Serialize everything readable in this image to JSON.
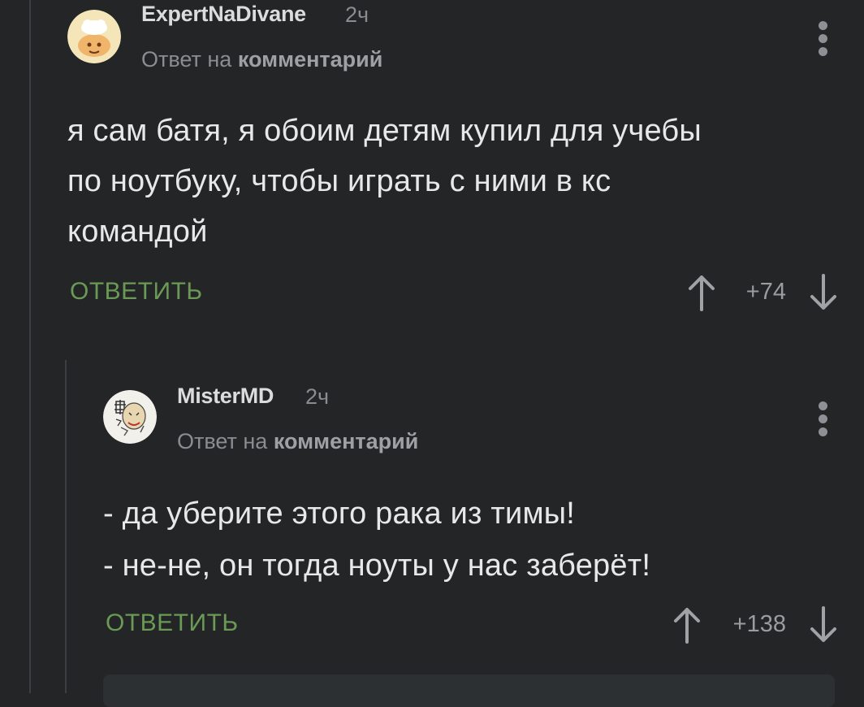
{
  "comments": [
    {
      "username": "ExpertNaDivane",
      "time": "2ч",
      "reply_prefix": "Ответ на",
      "reply_target": "комментарий",
      "body": [
        "я сам батя, я обоим детям купил для учебы",
        "по ноутбуку, чтобы играть с ними в кс",
        "командой"
      ],
      "reply_label": "ОТВЕТИТЬ",
      "score": "+74",
      "avatar_icon": "cook-avatar-icon"
    },
    {
      "username": "MisterMD",
      "time": "2ч",
      "reply_prefix": "Ответ на",
      "reply_target": "комментарий",
      "body": [
        "- да уберите этого рака из тимы!",
        "- не-не, он тогда ноуты у нас заберёт!"
      ],
      "reply_label": "ОТВЕТИТЬ",
      "score": "+138",
      "avatar_icon": "sketch-avatar-icon"
    }
  ],
  "colors": {
    "background": "#232527",
    "accent_reply": "#6a9a56",
    "muted": "#8a8d90"
  }
}
